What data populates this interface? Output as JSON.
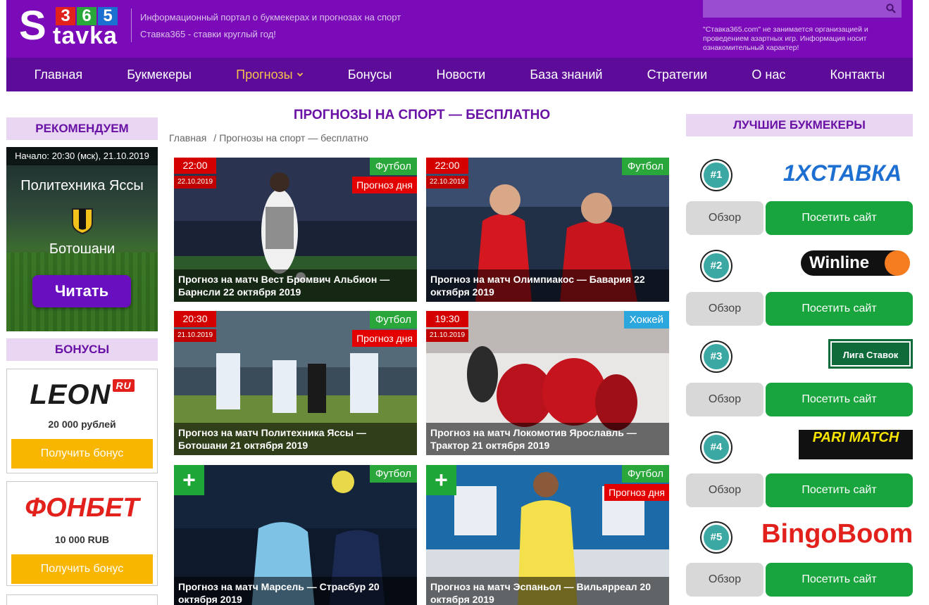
{
  "header": {
    "logo": {
      "letter": "S",
      "digits": [
        "3",
        "6",
        "5"
      ],
      "word": "tavka"
    },
    "tagline1": "Информационный портал о букмекерах и прогнозах на спорт",
    "tagline2": "Ставка365 - ставки круглый год!",
    "search_placeholder": "",
    "disclaimer": "\"Ставка365.com\" не занимается организацией и проведением азартных игр. Информация носит ознакомительный характер!"
  },
  "nav": {
    "items": [
      "Главная",
      "Букмекеры",
      "Прогнозы",
      "Бонусы",
      "Новости",
      "База знаний",
      "Стратегии",
      "О нас",
      "Контакты"
    ],
    "active": "Прогнозы"
  },
  "left": {
    "recommend_title": "РЕКОМЕНДУЕМ",
    "rec": {
      "start": "Начало: 20:30 (мск), 21.10.2019",
      "team1": "Политехника Яссы",
      "team2": "Ботошани",
      "read": "Читать"
    },
    "bonus_title": "БОНУСЫ",
    "bonuses": [
      {
        "logo": "LEON",
        "logo_suffix": "RU",
        "amount": "20 000 рублей",
        "button": "Получить бонус"
      },
      {
        "logo": "ФОНБЕТ",
        "amount": "10 000 RUB",
        "button": "Получить бонус"
      }
    ]
  },
  "main": {
    "title": "ПРОГНОЗЫ НА СПОРТ — БЕСПЛАТНО",
    "breadcrumb": [
      "Главная",
      "Прогнозы на спорт — бесплатно"
    ],
    "cards": [
      {
        "time": "22:00",
        "date": "22.10.2019",
        "sport": "Футбол",
        "day": "Прогноз дня",
        "title": "Прогноз на матч Вест Бромвич Альбион — Барнсли 22 октября 2019"
      },
      {
        "time": "22:00",
        "date": "22.10.2019",
        "sport": "Футбол",
        "title": "Прогноз на матч Олимпиакос — Бавария 22 октября 2019"
      },
      {
        "time": "20:30",
        "date": "21.10.2019",
        "sport": "Футбол",
        "day": "Прогноз дня",
        "title": "Прогноз на матч Политехника Яссы — Ботошани 21 октября 2019"
      },
      {
        "time": "19:30",
        "date": "21.10.2019",
        "sport": "Хоккей",
        "title": "Прогноз на матч Локомотив Ярославль — Трактор 21 октября 2019"
      },
      {
        "plus": "+",
        "sport": "Футбол",
        "title": "Прогноз на матч Марсель — Страсбур 20 октября 2019"
      },
      {
        "plus": "+",
        "sport": "Футбол",
        "day": "Прогноз дня",
        "title": "Прогноз на матч Эспаньол — Вильярреал 20 октября 2019"
      }
    ]
  },
  "right": {
    "title": "ЛУЧШИЕ БУКМЕКЕРЫ",
    "bookmakers": [
      {
        "rank": "#1",
        "name": "1XСТАВКА",
        "overview": "Обзор",
        "visit": "Посетить сайт"
      },
      {
        "rank": "#2",
        "name": "Winline",
        "overview": "Обзор",
        "visit": "Посетить сайт"
      },
      {
        "rank": "#3",
        "name": "Лига Ставок",
        "overview": "Обзор",
        "visit": "Посетить сайт"
      },
      {
        "rank": "#4",
        "name": "PARI MATCH",
        "overview": "Обзор",
        "visit": "Посетить сайт"
      },
      {
        "rank": "#5",
        "name": "BingoBoom",
        "overview": "Обзор",
        "visit": "Посетить сайт"
      }
    ]
  },
  "colors": {
    "brand": "#7b0bb8",
    "nav": "#5c0c98",
    "accent": "#f6c04d",
    "green": "#19a53e",
    "red": "#d40000"
  }
}
